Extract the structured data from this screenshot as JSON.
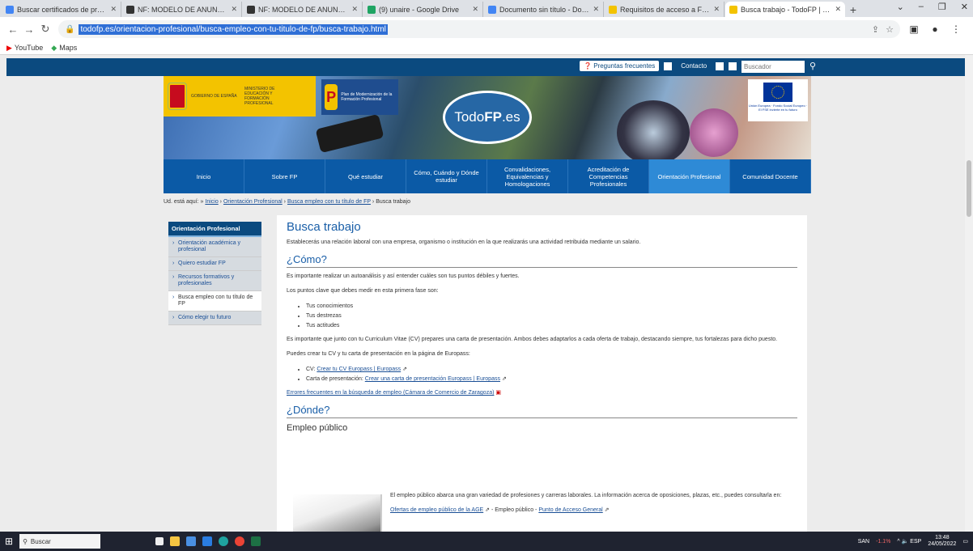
{
  "browser": {
    "tabs": [
      {
        "title": "Buscar certificados de profesi",
        "color": "#4285f4"
      },
      {
        "title": "NF: MODELO DE ANUNCIO II",
        "color": "#333333"
      },
      {
        "title": "NF: MODELO DE ANUNCIO II",
        "color": "#333333"
      },
      {
        "title": "(9) unaire - Google Drive",
        "color": "#1fa463"
      },
      {
        "title": "Documento sin título - Docum",
        "color": "#4285f4"
      },
      {
        "title": "Requisitos de acceso a FP - TodoFP",
        "color": "#f3c300"
      },
      {
        "title": "Busca trabajo - TodoFP | Minist",
        "color": "#f3c300",
        "active": true
      }
    ],
    "url": "todofp.es/orientacion-profesional/busca-empleo-con-tu-titulo-de-fp/busca-trabajo.html",
    "bookmarks": [
      "YouTube",
      "Maps"
    ],
    "window_controls": [
      "⌄",
      "–",
      "❐",
      "✕"
    ]
  },
  "site": {
    "top_links": {
      "faq": "Preguntas frecuentes",
      "contact": "Contacto"
    },
    "search_placeholder": "Buscador",
    "brand": {
      "todo": "Todo",
      "fp": "FP",
      "es": ".es"
    },
    "gov": {
      "line1": "GOBIERNO DE ESPAÑA",
      "line2": "MINISTERIO DE EDUCACIÓN Y FORMACIÓN PROFESIONAL"
    },
    "ministry": "Plan de Modernización de la Formación Profesional",
    "eu": "Unión Europea · Fondo Social Europeo · El FSE invierte en tu futuro",
    "menu": [
      "Inicio",
      "Sobre FP",
      "Qué estudiar",
      "Cómo, Cuándo y Dónde estudiar",
      "Convalidaciones, Equivalencias y Homologaciones",
      "Acreditación de Competencias Profesionales",
      "Orientación Profesional",
      "Comunidad Docente"
    ],
    "active_menu_index": 6
  },
  "breadcrumb": {
    "prefix": "Ud. está aquí:",
    "items": [
      "Inicio",
      "Orientación Profesional",
      "Busca empleo con tu título de FP"
    ],
    "current": "Busca trabajo"
  },
  "sidebar": {
    "title": "Orientación Profesional",
    "items": [
      "Orientación académica y profesional",
      "Quiero estudiar FP",
      "Recursos formativos y profesionales",
      "Busca empleo con tu título de FP",
      "Cómo elegir tu futuro"
    ],
    "current_index": 3
  },
  "content": {
    "title": "Busca trabajo",
    "intro": "Establecerás una relación laboral con una empresa, organismo o institución en la que realizarás una actividad retribuida mediante un salario.",
    "como": {
      "heading": "¿Cómo?",
      "p1": "Es importante realizar un autoanálisis y así entender cuáles son tus puntos débiles y fuertes.",
      "p2": "Los puntos clave que debes medir en esta primera fase son:",
      "list": [
        "Tus conocimientos",
        "Tus destrezas",
        "Tus actitudes"
      ],
      "p3": "Es importante que junto con tu Curriculum Vitae (CV) prepares una carta de presentación. Ambos debes adaptarlos a cada oferta de trabajo, destacando siempre, tus fortalezas para dicho puesto.",
      "p4": "Puedes crear tu CV y tu carta de presentación en la página de Europass:",
      "links": [
        {
          "label": "CV:",
          "text": "Crear tu CV Europass | Europass"
        },
        {
          "label": "Carta de presentación:",
          "text": "Crear una carta de presentación Europass | Europass"
        }
      ],
      "pdf_link": "Errores frecuentes en la búsqueda de empleo (Cámara de Comercio de Zaragoza)"
    },
    "donde": {
      "heading": "¿Dónde?",
      "subheading": "Empleo público",
      "p1": "El empleo público abarca una gran variedad de profesiones y carreras laborales. La información acerca de oposiciones, plazas, etc., puedes consultarla en:",
      "link1": "Ofertas de empleo público de la AGE",
      "sep": " - Empleo público - ",
      "link2": "Punto de Acceso General"
    }
  },
  "taskbar": {
    "search": "Buscar",
    "tray": [
      "SAN",
      "-1.1%",
      "^ 🔈 ESP",
      "13:48",
      "24/05/2022"
    ]
  }
}
